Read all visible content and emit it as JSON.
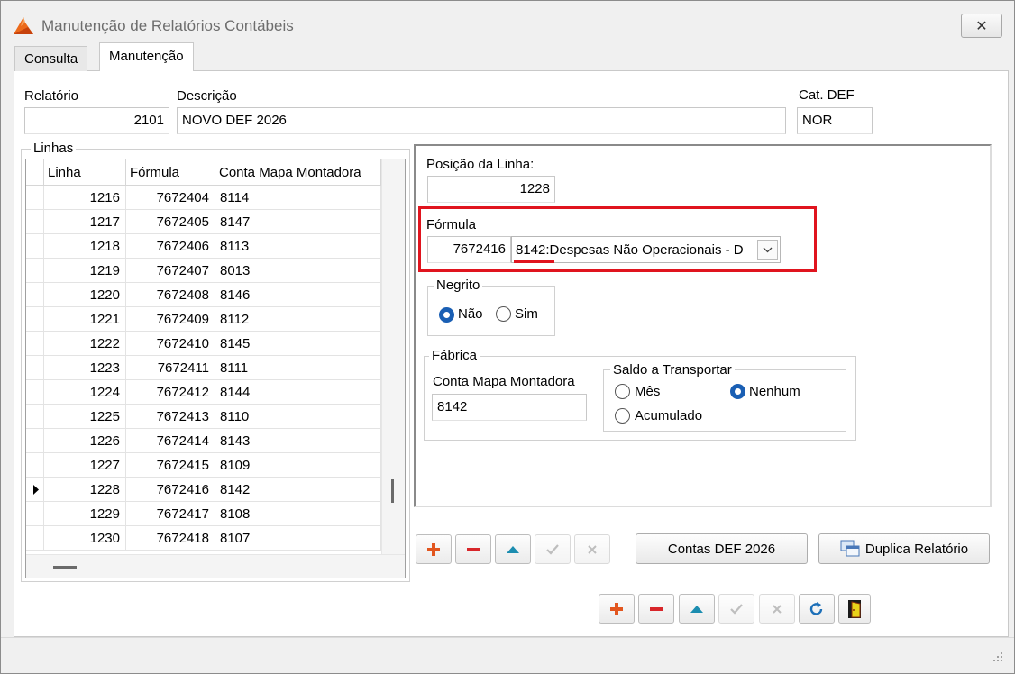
{
  "window": {
    "title": "Manutenção de Relatórios Contábeis",
    "close_symbol": "✕"
  },
  "tabs": [
    {
      "label": "Consulta"
    },
    {
      "label": "Manutenção"
    }
  ],
  "header": {
    "relatorio_label": "Relatório",
    "relatorio_value": "2101",
    "descricao_label": "Descrição",
    "descricao_value": "NOVO DEF 2026",
    "catdef_label": "Cat. DEF",
    "catdef_value": "NOR"
  },
  "linhas": {
    "title": "Linhas",
    "columns": [
      "Linha",
      "Fórmula",
      "Conta Mapa Montadora"
    ],
    "current_row_index": 12,
    "rows": [
      [
        "1216",
        "7672404",
        "8114"
      ],
      [
        "1217",
        "7672405",
        "8147"
      ],
      [
        "1218",
        "7672406",
        "8113"
      ],
      [
        "1219",
        "7672407",
        "8013"
      ],
      [
        "1220",
        "7672408",
        "8146"
      ],
      [
        "1221",
        "7672409",
        "8112"
      ],
      [
        "1222",
        "7672410",
        "8145"
      ],
      [
        "1223",
        "7672411",
        "8111"
      ],
      [
        "1224",
        "7672412",
        "8144"
      ],
      [
        "1225",
        "7672413",
        "8110"
      ],
      [
        "1226",
        "7672414",
        "8143"
      ],
      [
        "1227",
        "7672415",
        "8109"
      ],
      [
        "1228",
        "7672416",
        "8142"
      ],
      [
        "1229",
        "7672417",
        "8108"
      ],
      [
        "1230",
        "7672418",
        "8107"
      ]
    ]
  },
  "detail": {
    "posicao_label": "Posição da Linha:",
    "posicao_value": "1228",
    "formula_label": "Fórmula",
    "formula_code": "7672416",
    "formula_select_code": "8142",
    "formula_select_text": ":Despesas Não Operacionais - D",
    "negrito": {
      "title": "Negrito",
      "options": [
        "Não",
        "Sim"
      ],
      "selected": "Não"
    },
    "fabrica": {
      "title": "Fábrica",
      "conta_label": "Conta Mapa Montadora",
      "conta_value": "8142",
      "saldo": {
        "title": "Saldo a Transportar",
        "options": [
          "Mês",
          "Nenhum",
          "Acumulado"
        ],
        "selected": "Nenhum"
      }
    }
  },
  "buttons": {
    "contas_def": "Contas DEF 2026",
    "duplica": "Duplica Relatório"
  },
  "colors": {
    "highlight_border": "#e0141e",
    "underline": "#e0141e",
    "radio_selected": "#1a5fb4"
  }
}
